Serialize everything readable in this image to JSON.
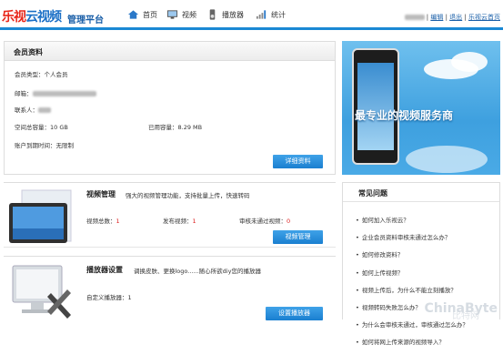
{
  "header": {
    "logo_a": "乐视",
    "logo_b": "云视频",
    "subtitle": "管理平台",
    "nav": [
      {
        "label": "首页",
        "icon": "home-icon"
      },
      {
        "label": "视频",
        "icon": "monitor-icon"
      },
      {
        "label": "播放器",
        "icon": "player-icon"
      },
      {
        "label": "统计",
        "icon": "bar-chart-icon"
      }
    ],
    "user_links": [
      "编辑",
      "退出",
      "乐视云首页"
    ],
    "sep": "|"
  },
  "account": {
    "title": "会员资料",
    "type_label": "会员类型：",
    "type_value": "个人会员",
    "email_label": "邮箱：",
    "contact_label": "联系人：",
    "space_label": "空间总容量：",
    "space_value": "10 GB",
    "used_label": "已用容量：",
    "used_value": "8.29 MB",
    "expire_label": "账户到期时间：",
    "expire_value": "无限制",
    "button": "详细资料"
  },
  "banner": {
    "text": "最专业的视频服务商"
  },
  "video": {
    "title": "视频管理",
    "desc": "强大的视频管理功能，支持批量上传，快速转码",
    "total_label": "视频总数：",
    "total_value": "1",
    "published_label": "发布视频：",
    "published_value": "1",
    "rejected_label": "审核未通过视频：",
    "rejected_value": "0",
    "button": "视频管理"
  },
  "player": {
    "title": "播放器设置",
    "desc": "调换皮肤、更换logo......随心所欲diy您的播放器",
    "custom_label": "自定义播放器：",
    "custom_value": "1",
    "button": "设置播放器"
  },
  "faq": {
    "title": "常见问题",
    "items": [
      "如何加入乐视云？",
      "企业会员资料审核未通过怎么办？",
      "如何修改资料？",
      "如何上传视频？",
      "视频上传后，为什么不能立刻播放？",
      "视频转码失败怎么办？",
      "为什么会审核未通过，审核通过怎么办？",
      "如何将网上传来源的视频导入？"
    ]
  },
  "watermark": {
    "text": "ChinaByte",
    "sub": "比特网"
  }
}
